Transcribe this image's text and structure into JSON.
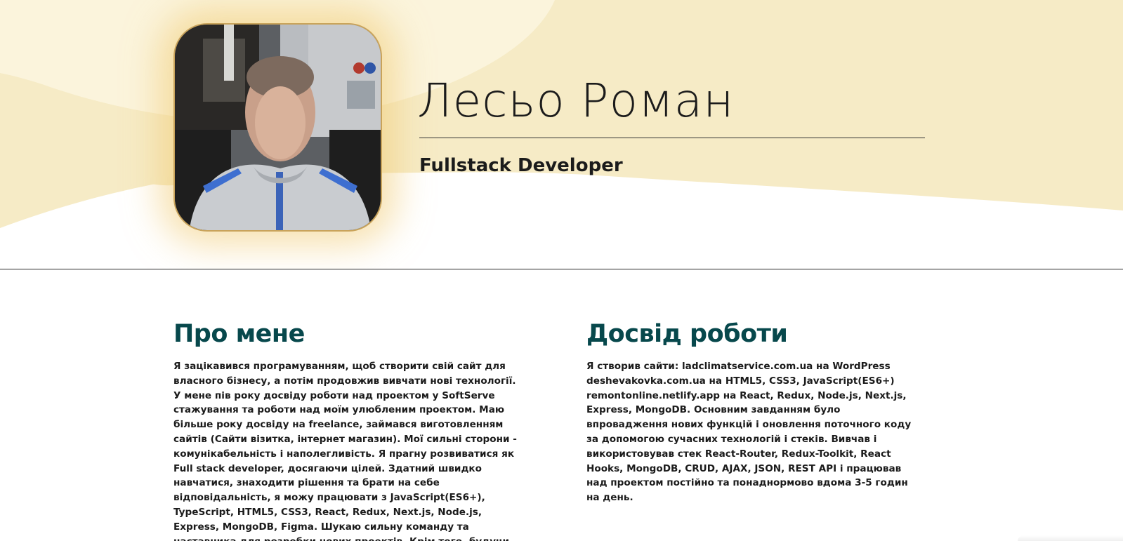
{
  "colors": {
    "hero_cream": "#f6ebc6",
    "accent_gold": "#c9a35a",
    "heading_teal": "#07484c",
    "text_dark": "#1b1b1b"
  },
  "profile": {
    "name": "Лесьо Роман",
    "role": "Fullstack Developer",
    "photo_icon": "profile-photo"
  },
  "about": {
    "title": "Про мене",
    "text": "Я зацікавився програмуванням, щоб створити свій сайт для\nвласного бізнесу, а потім продовжив вивчати нові технології.\nУ мене пів року досвіду роботи над проектом у SoftServe\nстажування та роботи над моїм улюбленим проектом. Маю\nбільше року досвіду на freelance, займався виготовленням\nсайтів (Сайти візитка, інтернет магазин). Мої сильні сторони -\nкомунікабельність і наполегливість. Я прагну розвиватися як\nFull stack developer, досягаючи цілей. Здатний швидко\nнавчатися, знаходити рішення та брати на себе\nвідповідальність, я можу працювати з JavaScript(ES6+),\nTypeScript, HTML5, CSS3, React, Redux, Next.js, Node.js,\nExpress, MongoDB, Figma. Шукаю сильну команду та\nнаставника для розробки нових проектів. Крім того, будучи"
  },
  "experience": {
    "title": "Досвід роботи",
    "text": "Я створив сайти: ladclimatservice.com.ua на WordPress\ndeshevakovka.com.ua на HTML5, CSS3, JavaScript(ES6+)\nremontonline.netlify.app на React, Redux, Node.js, Next.js,\nExpress, MongoDB. Основним завданням було\nвпровадження нових функцій і оновлення поточного коду\nза допомогою сучасних технологій і стеків. Вивчав і\nвикористовував стек React-Router, Redux-Toolkit, React\nHooks, MongoDB, CRUD, AJAX, JSON, REST API і працював\nнад проектом постійно та понаднормово вдома 3-5 годин\nна день."
  }
}
